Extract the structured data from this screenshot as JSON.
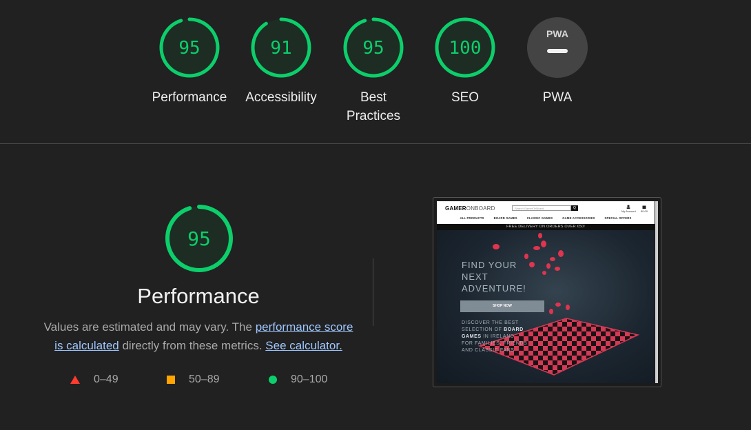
{
  "colors": {
    "background": "#212121",
    "pass": "#0cce6b",
    "average": "#ffa400",
    "fail": "#ff3b30",
    "link": "#9ec7ff"
  },
  "scores": [
    {
      "score": "95",
      "value": 95,
      "label": "Performance"
    },
    {
      "score": "91",
      "value": 91,
      "label": "Accessibility"
    },
    {
      "score": "95",
      "value": 95,
      "label": "Best Practices"
    },
    {
      "score": "100",
      "value": 100,
      "label": "SEO"
    }
  ],
  "pwa": {
    "badge": "PWA",
    "label": "PWA",
    "icon": "pwa-dash-icon"
  },
  "performance": {
    "score": "95",
    "value": 95,
    "title": "Performance",
    "desc_text_1": "Values are estimated and may vary. The ",
    "desc_link_1": "performance score is calculated",
    "desc_text_2": " directly from these metrics. ",
    "desc_link_2": "See calculator."
  },
  "legend": [
    {
      "range": "0–49",
      "icon": "triangle-fail-icon"
    },
    {
      "range": "50–89",
      "icon": "square-average-icon"
    },
    {
      "range": "90–100",
      "icon": "circle-pass-icon"
    }
  ],
  "screenshot": {
    "logo_bold": "GAMER",
    "logo_light": "ONBOARD",
    "search_placeholder": "Search GamerOnBoard",
    "search_button": "Q",
    "account_label": "My Account",
    "bag_label": "€0.00",
    "menu": [
      "ALL PRODUCTS",
      "BOARD GAMES",
      "CLASSIC GAMES",
      "GAME ACCESSORIES",
      "SPECIAL OFFERS"
    ],
    "delivery_banner": "FREE DELIVERY ON ORDERS OVER €50!",
    "hero_line1": "FIND YOUR",
    "hero_line2": "NEXT",
    "hero_line3": "ADVENTURE!",
    "shop_button": "SHOP NOW",
    "sub_line1": "DISCOVER THE BEST",
    "sub_line2_pre": "SELECTION OF ",
    "sub_line2_bold": "BOARD",
    "sub_line3_bold": "GAMES",
    "sub_line3_post": " IN IRELAND",
    "sub_line4": "FOR FAMILIES, FRIENDS",
    "sub_line5": "AND CLASSIC FANS"
  }
}
